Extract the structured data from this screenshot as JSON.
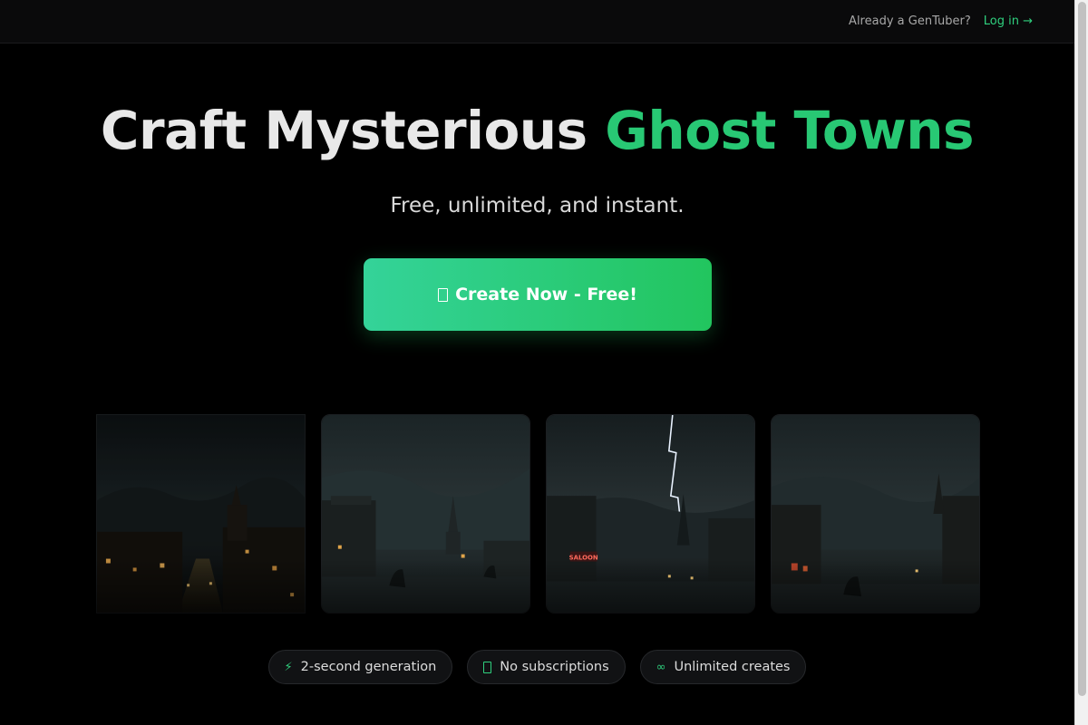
{
  "topbar": {
    "prompt": "Already a GenTuber?",
    "login_label": "Log in →"
  },
  "hero": {
    "title_main": "Craft Mysterious ",
    "title_accent": "Ghost Towns",
    "subtitle": "Free, unlimited, and instant."
  },
  "cta": {
    "icon": "box-glyph-icon",
    "label": "Create Now - Free!"
  },
  "gallery": {
    "images": [
      {
        "name": "ghost-town-night-street"
      },
      {
        "name": "ghost-town-foggy-church"
      },
      {
        "name": "ghost-town-lightning-saloon",
        "sign_text": "SALOON"
      },
      {
        "name": "ghost-town-dusk-horses"
      }
    ]
  },
  "features": [
    {
      "icon": "lightning-icon",
      "glyph": "⚡",
      "label": "2-second generation"
    },
    {
      "icon": "box-glyph-icon",
      "glyph": "",
      "label": "No subscriptions"
    },
    {
      "icon": "infinity-icon",
      "glyph": "∞",
      "label": "Unlimited creates"
    }
  ],
  "colors": {
    "background": "#000000",
    "accent": "#28c874",
    "cta_gradient_start": "#34d399",
    "cta_gradient_end": "#22c55e"
  }
}
